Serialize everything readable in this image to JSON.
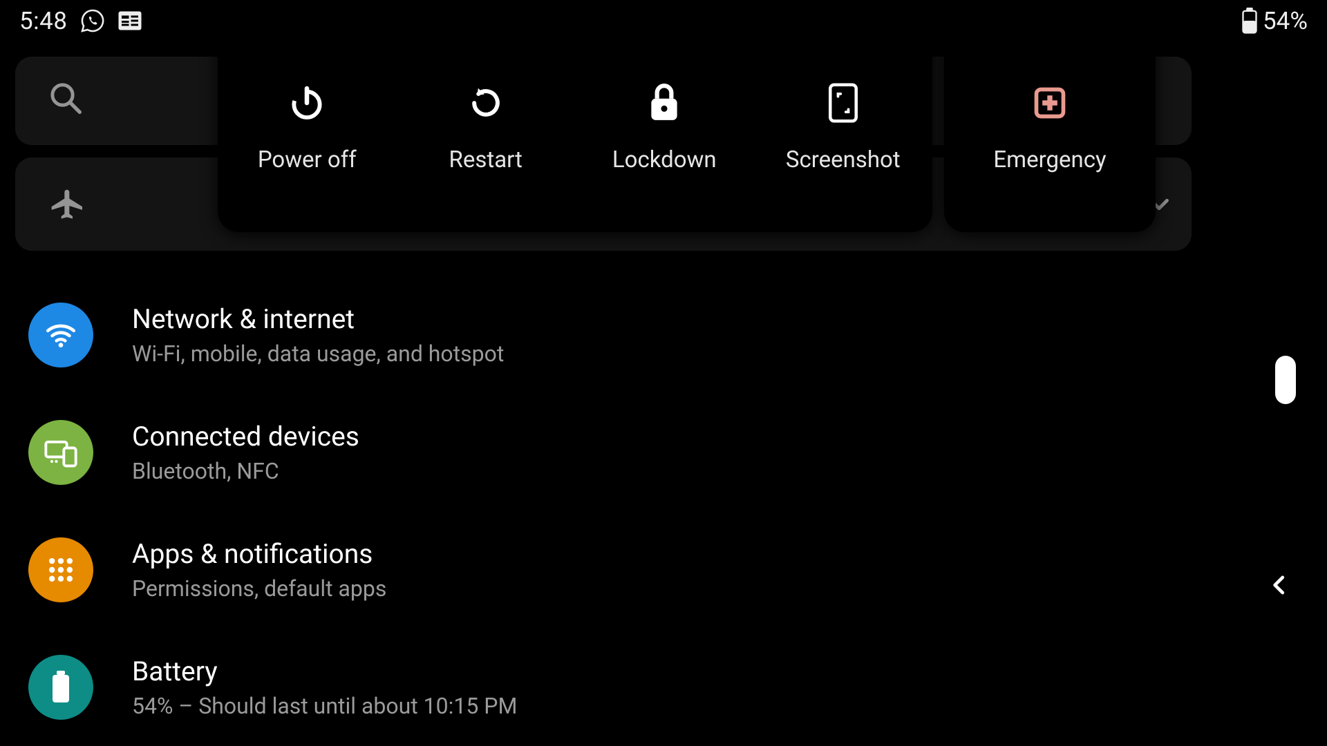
{
  "status": {
    "time": "5:48",
    "battery": "54%"
  },
  "power_menu": {
    "items": [
      {
        "label": "Power off"
      },
      {
        "label": "Restart"
      },
      {
        "label": "Lockdown"
      },
      {
        "label": "Screenshot"
      }
    ],
    "emergency": {
      "label": "Emergency"
    }
  },
  "settings": [
    {
      "title": "Network & internet",
      "subtitle": "Wi‑Fi, mobile, data usage, and hotspot"
    },
    {
      "title": "Connected devices",
      "subtitle": "Bluetooth, NFC"
    },
    {
      "title": "Apps & notifications",
      "subtitle": "Permissions, default apps"
    },
    {
      "title": "Battery",
      "subtitle": "54% – Should last until about 10:15 PM"
    }
  ]
}
